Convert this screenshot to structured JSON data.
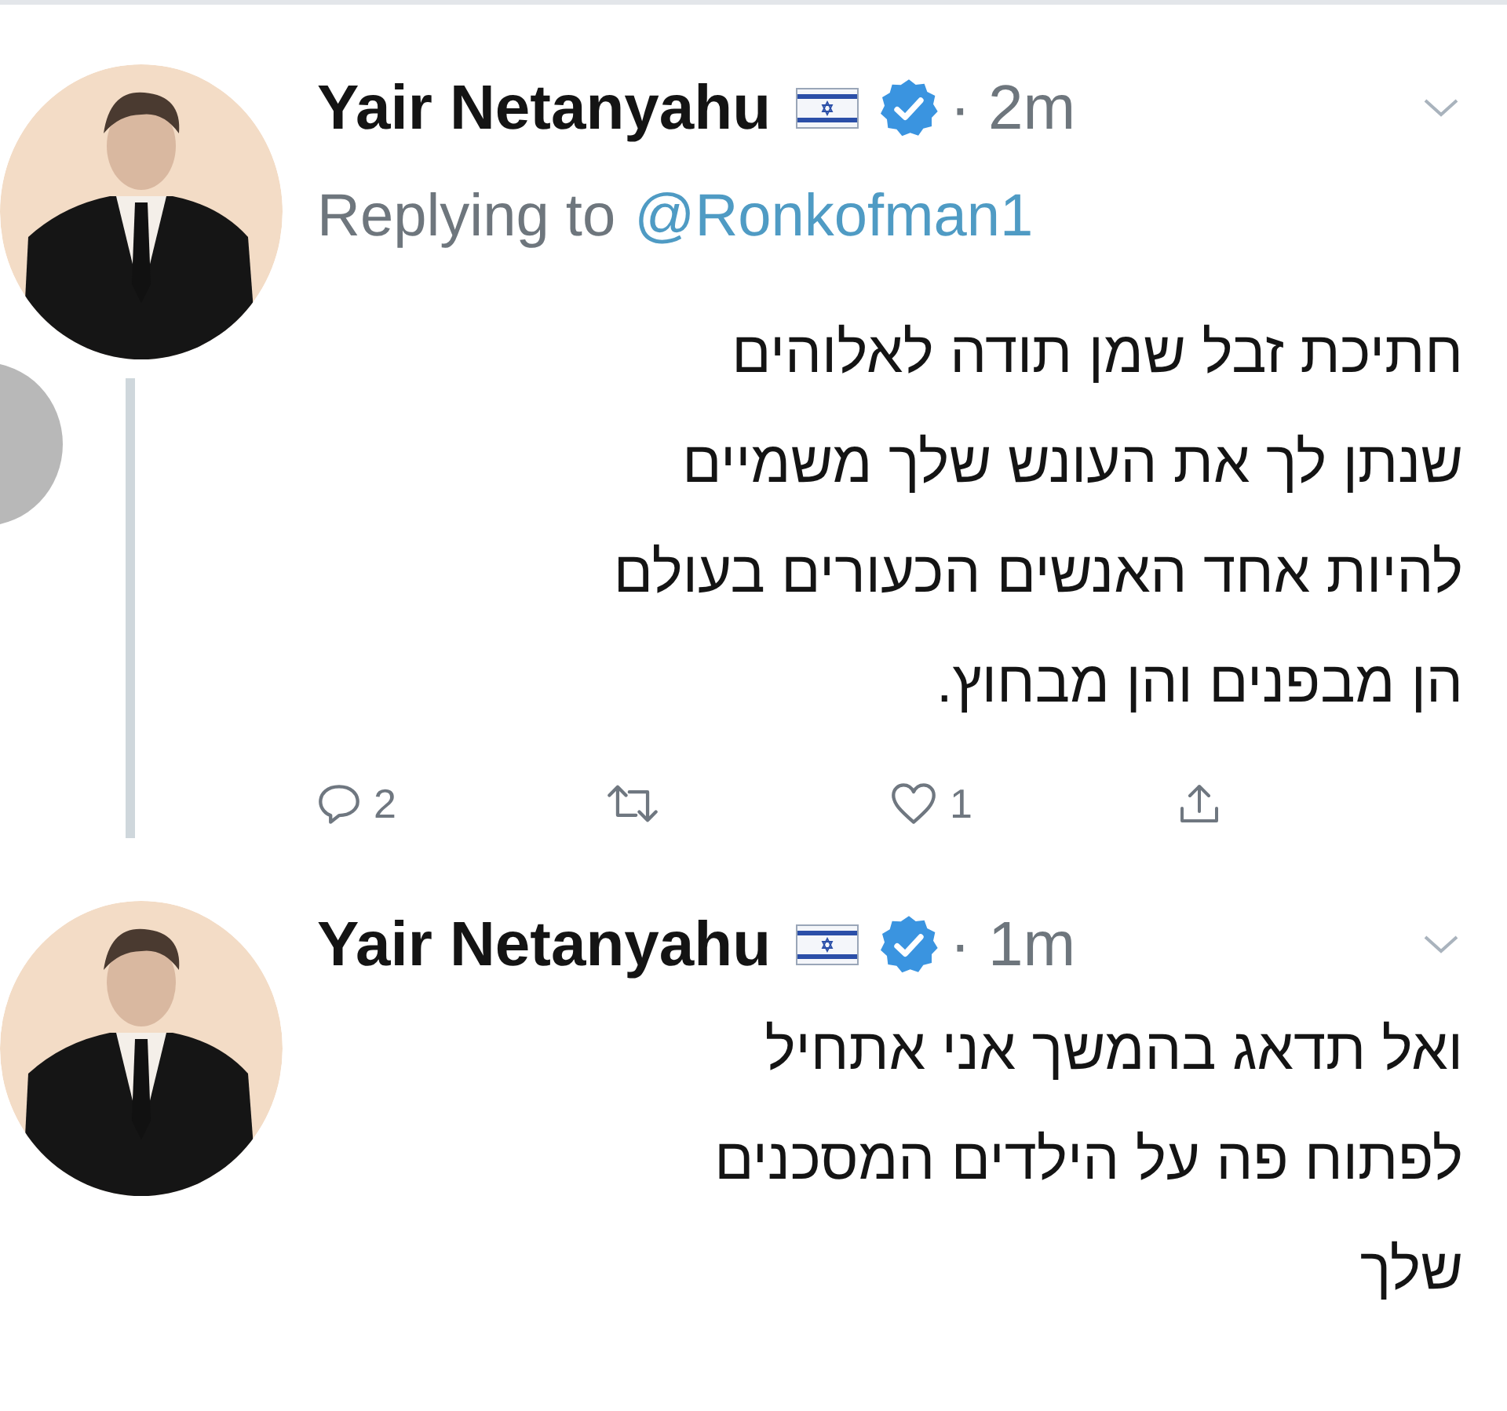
{
  "tweets": [
    {
      "author": "Yair Netanyahu",
      "time": "· 2m",
      "reply_to": {
        "prefix": "Replying to",
        "handle": "@Ronkofman1"
      },
      "text": "חתיכת זבל שמן תודה לאלוהים\nשנתן לך את העונש שלך משמיים\nלהיות אחד האנשים הכעורים בעולם\nהן מבפנים והן מבחוץ.",
      "thread_line": true,
      "actions": {
        "replies": "2",
        "likes": "1"
      }
    },
    {
      "author": "Yair Netanyahu",
      "time": "· 1m",
      "text": "ואל תדאג בהמשך אני אתחיל\nלפתוח פה על הילדים המסכנים\nשלך",
      "thread_line": false
    }
  ]
}
